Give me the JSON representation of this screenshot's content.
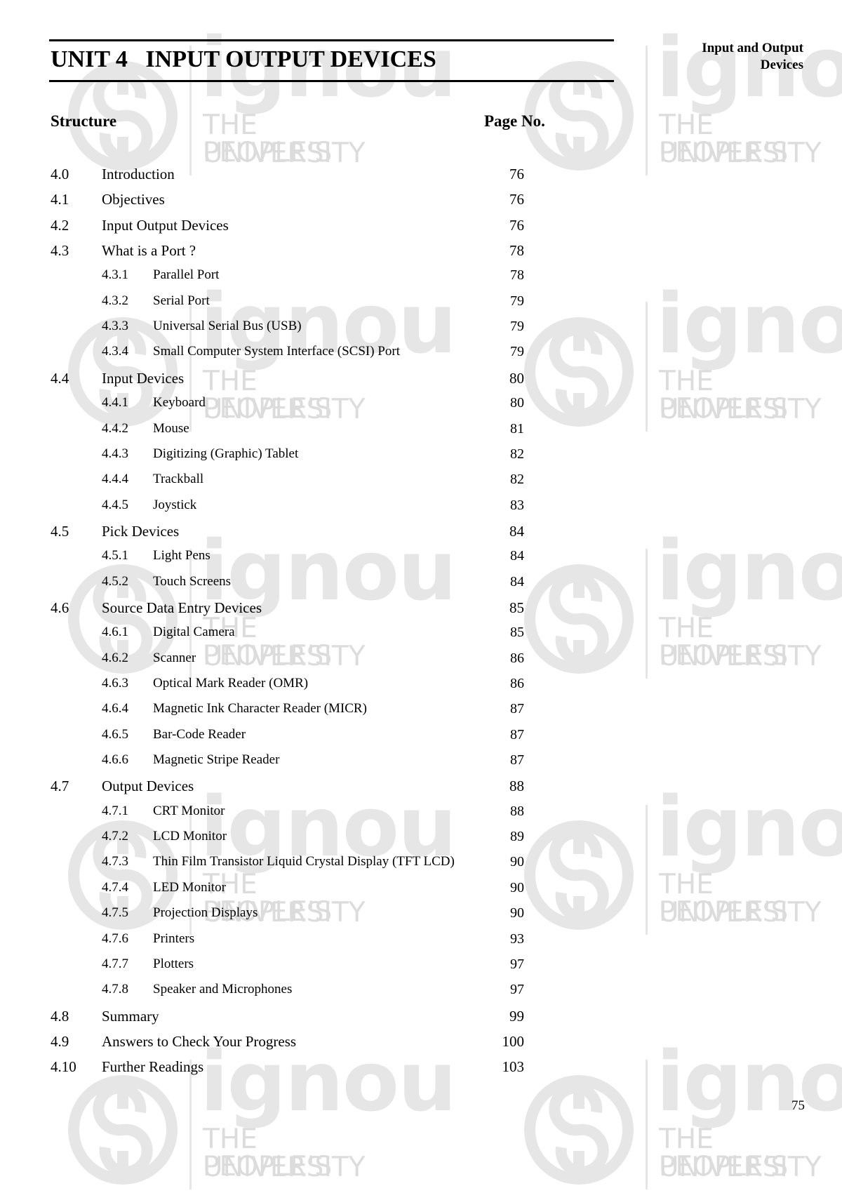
{
  "header": {
    "unit_title": "UNIT 4   INPUT OUTPUT DEVICES",
    "running_head_line1": "Input and Output",
    "running_head_line2": "Devices"
  },
  "structure": {
    "heading": "Structure",
    "page_heading": "Page No.",
    "entries": [
      {
        "level": 1,
        "number": "4.0",
        "title": "Introduction",
        "page": "76"
      },
      {
        "level": 1,
        "number": "4.1",
        "title": "Objectives",
        "page": "76"
      },
      {
        "level": 1,
        "number": "4.2",
        "title": "Input Output Devices",
        "page": "76"
      },
      {
        "level": 1,
        "number": "4.3",
        "title": "What is a Port ?",
        "page": "78"
      },
      {
        "level": 2,
        "number": "4.3.1",
        "title": "Parallel Port",
        "page": "78"
      },
      {
        "level": 2,
        "number": "4.3.2",
        "title": "Serial Port",
        "page": "79"
      },
      {
        "level": 2,
        "number": "4.3.3",
        "title": "Universal Serial Bus (USB)",
        "page": "79"
      },
      {
        "level": 2,
        "number": "4.3.4",
        "title": "Small Computer System Interface (SCSI) Port",
        "page": "79"
      },
      {
        "level": 1,
        "number": "4.4",
        "title": "Input Devices",
        "page": "80"
      },
      {
        "level": 2,
        "number": "4.4.1",
        "title": "Keyboard",
        "page": "80"
      },
      {
        "level": 2,
        "number": "4.4.2",
        "title": "Mouse",
        "page": "81"
      },
      {
        "level": 2,
        "number": "4.4.3",
        "title": "Digitizing (Graphic) Tablet",
        "page": "82"
      },
      {
        "level": 2,
        "number": "4.4.4",
        "title": "Trackball",
        "page": "82"
      },
      {
        "level": 2,
        "number": "4.4.5",
        "title": "Joystick",
        "page": "83"
      },
      {
        "level": 1,
        "number": "4.5",
        "title": "Pick Devices",
        "page": "84"
      },
      {
        "level": 2,
        "number": "4.5.1",
        "title": "Light Pens",
        "page": "84"
      },
      {
        "level": 2,
        "number": "4.5.2",
        "title": "Touch Screens",
        "page": "84"
      },
      {
        "level": 1,
        "number": "4.6",
        "title": "Source Data Entry Devices",
        "page": "85"
      },
      {
        "level": 2,
        "number": "4.6.1",
        "title": "Digital Camera",
        "page": "85"
      },
      {
        "level": 2,
        "number": "4.6.2",
        "title": "Scanner",
        "page": "86"
      },
      {
        "level": 2,
        "number": "4.6.3",
        "title": "Optical Mark Reader (OMR)",
        "page": "86"
      },
      {
        "level": 2,
        "number": "4.6.4",
        "title": "Magnetic Ink Character Reader (MICR)",
        "page": "87"
      },
      {
        "level": 2,
        "number": "4.6.5",
        "title": "Bar-Code Reader",
        "page": "87"
      },
      {
        "level": 2,
        "number": "4.6.6",
        "title": "Magnetic Stripe Reader",
        "page": "87"
      },
      {
        "level": 1,
        "number": "4.7",
        "title": "Output Devices",
        "page": "88"
      },
      {
        "level": 2,
        "number": "4.7.1",
        "title": "CRT Monitor",
        "page": "88"
      },
      {
        "level": 2,
        "number": "4.7.2",
        "title": "LCD Monitor",
        "page": "89"
      },
      {
        "level": 2,
        "number": "4.7.3",
        "title": "Thin Film Transistor Liquid Crystal Display (TFT LCD)",
        "page": "90"
      },
      {
        "level": 2,
        "number": "4.7.4",
        "title": "LED Monitor",
        "page": "90"
      },
      {
        "level": 2,
        "number": "4.7.5",
        "title": "Projection Displays",
        "page": "90"
      },
      {
        "level": 2,
        "number": "4.7.6",
        "title": "Printers",
        "page": "93"
      },
      {
        "level": 2,
        "number": "4.7.7",
        "title": "Plotters",
        "page": "97"
      },
      {
        "level": 2,
        "number": "4.7.8",
        "title": "Speaker and Microphones",
        "page": "97"
      },
      {
        "level": 1,
        "number": "4.8",
        "title": "Summary",
        "page": "99"
      },
      {
        "level": 1,
        "number": "4.9",
        "title": "Answers to Check Your Progress",
        "page": "100"
      },
      {
        "level": 1,
        "number": "4.10",
        "title": "Further Readings",
        "page": "103"
      }
    ]
  },
  "watermark": {
    "brand": "ignou",
    "tagline_line1": "THE PEOPLE'S",
    "tagline_line2": "UNIVERSITY",
    "icon": "ignou-logo-icon"
  },
  "footer": {
    "page_number": "75"
  }
}
